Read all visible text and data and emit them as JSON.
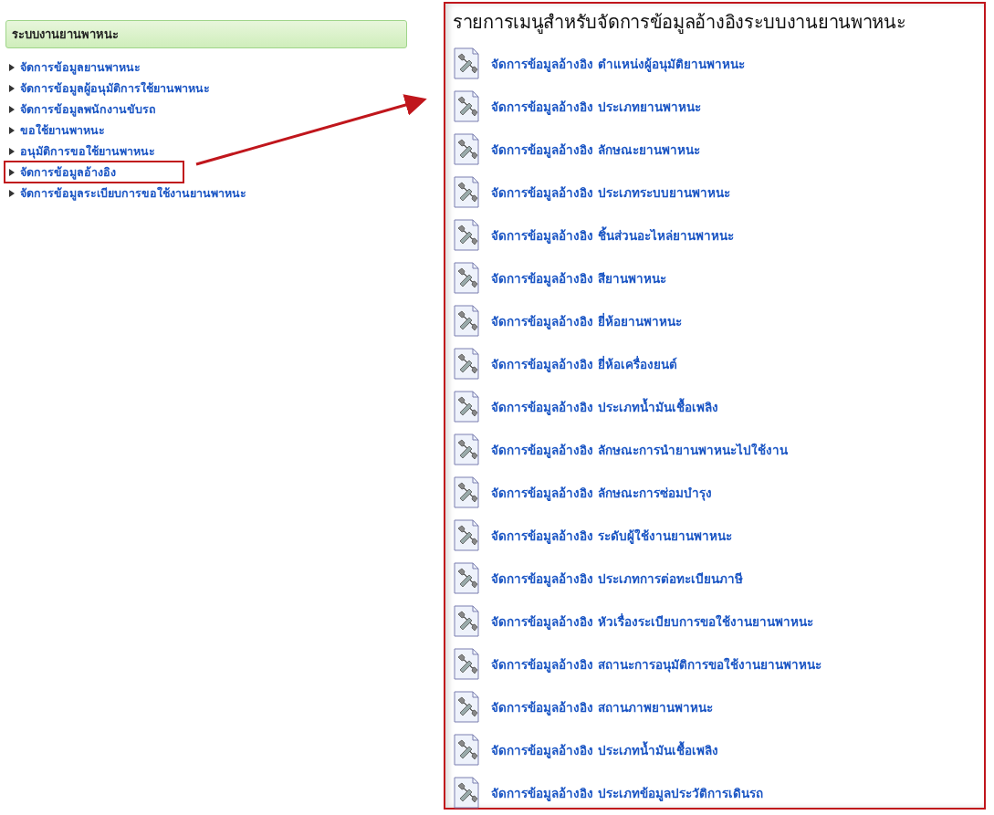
{
  "sidebar": {
    "title": "ระบบงานยานพาหนะ",
    "items": [
      {
        "label": "จัดการข้อมูลยานพาหนะ",
        "selected": false
      },
      {
        "label": "จัดการข้อมูลผู้อนุมัติการใช้ยานพาหนะ",
        "selected": false
      },
      {
        "label": "จัดการข้อมูลพนักงานขับรถ",
        "selected": false
      },
      {
        "label": "ขอใช้ยานพาหนะ",
        "selected": false
      },
      {
        "label": "อนุมัติการขอใช้ยานพาหนะ",
        "selected": false
      },
      {
        "label": "จัดการข้อมูลอ้างอิง",
        "selected": true
      },
      {
        "label": "จัดการข้อมูลระเบียบการขอใช้งานยานพาหนะ",
        "selected": false
      }
    ]
  },
  "menu": {
    "title": "รายการเมนูสำหรับจัดการข้อมูลอ้างอิงระบบงานยานพาหนะ",
    "items": [
      "จัดการข้อมูลอ้างอิง ตำแหน่งผู้อนุมัติยานพาหนะ",
      "จัดการข้อมูลอ้างอิง ประเภทยานพาหนะ",
      "จัดการข้อมูลอ้างอิง ลักษณะยานพาหนะ",
      "จัดการข้อมูลอ้างอิง ประเภทระบบยานพาหนะ",
      "จัดการข้อมูลอ้างอิง ชิ้นส่วนอะไหล่ยานพาหนะ",
      "จัดการข้อมูลอ้างอิง สียานพาหนะ",
      "จัดการข้อมูลอ้างอิง ยี่ห้อยานพาหนะ",
      "จัดการข้อมูลอ้างอิง ยี่ห้อเครื่องยนต์",
      "จัดการข้อมูลอ้างอิง ประเภทน้ำมันเชื้อเพลิง",
      "จัดการข้อมูลอ้างอิง ลักษณะการนำยานพาหนะไปใช้งาน",
      "จัดการข้อมูลอ้างอิง ลักษณะการซ่อมบำรุง",
      "จัดการข้อมูลอ้างอิง ระดับผู้ใช้งานยานพาหนะ",
      "จัดการข้อมูลอ้างอิง ประเภทการต่อทะเบียนภาษี",
      "จัดการข้อมูลอ้างอิง หัวเรื่องระเบียบการขอใช้งานยานพาหนะ",
      "จัดการข้อมูลอ้างอิง สถานะการอนุมัติการขอใช้งานยานพาหนะ",
      "จัดการข้อมูลอ้างอิง สถานภาพยานพาหนะ",
      "จัดการข้อมูลอ้างอิง ประเภทน้ำมันเชื้อเพลิง",
      "จัดการข้อมูลอ้างอิง ประเภทข้อมูลประวัติการเดินรถ"
    ]
  }
}
